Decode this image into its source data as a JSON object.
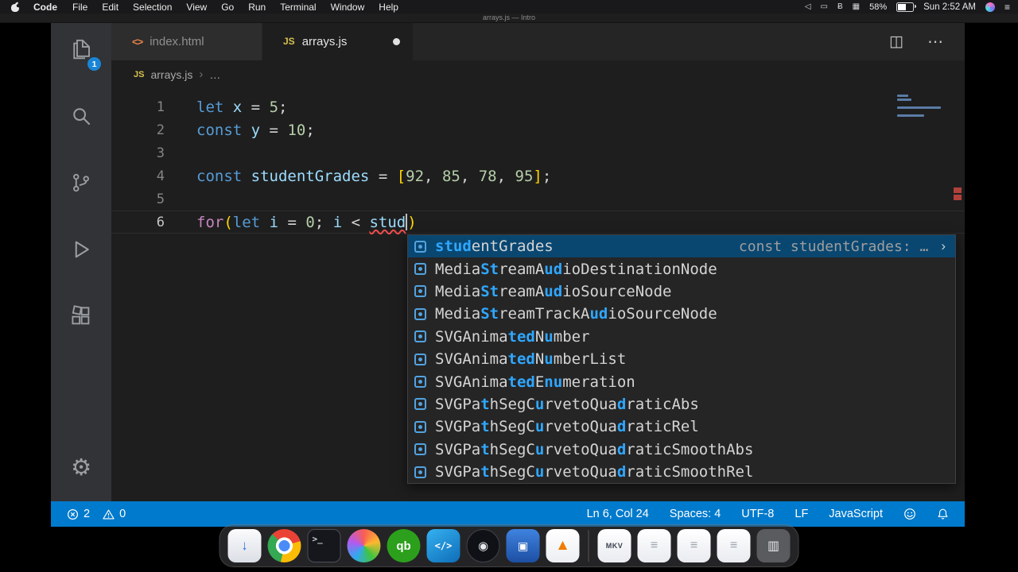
{
  "menubar": {
    "items": [
      "Code",
      "File",
      "Edit",
      "Selection",
      "View",
      "Go",
      "Run",
      "Terminal",
      "Window",
      "Help"
    ],
    "status_icons": [
      {
        "name": "volume-icon",
        "glyph": "◁"
      },
      {
        "name": "display-icon",
        "glyph": "▭"
      },
      {
        "name": "bluetooth-icon",
        "glyph": "Ƀ"
      },
      {
        "name": "keyboard-brightness-icon",
        "glyph": "▦"
      }
    ],
    "battery": "58%",
    "clock": "Sun 2:52 AM",
    "notification_icon": "≡"
  },
  "titlebar": {
    "title": "arrays.js — Intro"
  },
  "activity_bar": {
    "badge": "1"
  },
  "tabs": [
    {
      "label": "index.html",
      "icon_label": "<>",
      "icon_name": "html-file-icon",
      "icon_class": "tab-icon-html",
      "active": false,
      "dirty": false
    },
    {
      "label": "arrays.js",
      "icon_label": "JS",
      "icon_name": "js-file-icon",
      "icon_class": "tab-icon-js",
      "active": true,
      "dirty": true
    }
  ],
  "tab_actions": {
    "split": "◫",
    "more": "⋯"
  },
  "breadcrumb": {
    "icon_label": "JS",
    "file": "arrays.js",
    "separator": "›",
    "more": "…"
  },
  "editor": {
    "lines": [
      {
        "num": "1",
        "tokens": [
          {
            "t": "let",
            "c": "kw"
          },
          {
            "t": " "
          },
          {
            "t": "x",
            "c": "vr"
          },
          {
            "t": " = "
          },
          {
            "t": "5",
            "c": "nu"
          },
          {
            "t": ";"
          }
        ]
      },
      {
        "num": "2",
        "tokens": [
          {
            "t": "const",
            "c": "kw"
          },
          {
            "t": " "
          },
          {
            "t": "y",
            "c": "vr"
          },
          {
            "t": " = "
          },
          {
            "t": "10",
            "c": "nu"
          },
          {
            "t": ";"
          }
        ]
      },
      {
        "num": "3",
        "tokens": []
      },
      {
        "num": "4",
        "tokens": [
          {
            "t": "const",
            "c": "kw"
          },
          {
            "t": " "
          },
          {
            "t": "studentGrades",
            "c": "vr"
          },
          {
            "t": " = "
          },
          {
            "t": "[",
            "c": "br"
          },
          {
            "t": "92",
            "c": "nu"
          },
          {
            "t": ", "
          },
          {
            "t": "85",
            "c": "nu"
          },
          {
            "t": ", "
          },
          {
            "t": "78",
            "c": "nu"
          },
          {
            "t": ", "
          },
          {
            "t": "95",
            "c": "nu"
          },
          {
            "t": "]",
            "c": "br"
          },
          {
            "t": ";"
          }
        ]
      },
      {
        "num": "5",
        "tokens": []
      },
      {
        "num": "6",
        "current": true,
        "tokens": [
          {
            "t": "for",
            "c": "ct"
          },
          {
            "t": "(",
            "c": "br"
          },
          {
            "t": "let",
            "c": "kw"
          },
          {
            "t": " "
          },
          {
            "t": "i",
            "c": "vr"
          },
          {
            "t": " = "
          },
          {
            "t": "0",
            "c": "nu"
          },
          {
            "t": "; "
          },
          {
            "t": "i",
            "c": "vr"
          },
          {
            "t": " < "
          },
          {
            "t": "stud",
            "c": "er"
          },
          {
            "t": "",
            "c": "caret"
          },
          {
            "t": ")",
            "c": "br"
          }
        ]
      }
    ]
  },
  "suggest": {
    "items": [
      {
        "selected": true,
        "detail": "const studentGrades: …",
        "chevron": "›",
        "segments": [
          {
            "t": "stud",
            "h": true
          },
          {
            "t": "entGrades"
          }
        ]
      },
      {
        "segments": [
          {
            "t": "Media"
          },
          {
            "t": "St",
            "h": true
          },
          {
            "t": "reamA"
          },
          {
            "t": "ud",
            "h": true
          },
          {
            "t": "ioDestinationNode"
          }
        ]
      },
      {
        "segments": [
          {
            "t": "Media"
          },
          {
            "t": "St",
            "h": true
          },
          {
            "t": "reamA"
          },
          {
            "t": "ud",
            "h": true
          },
          {
            "t": "ioSourceNode"
          }
        ]
      },
      {
        "segments": [
          {
            "t": "Media"
          },
          {
            "t": "St",
            "h": true
          },
          {
            "t": "reamTrackA"
          },
          {
            "t": "ud",
            "h": true
          },
          {
            "t": "ioSourceNode"
          }
        ]
      },
      {
        "segments": [
          {
            "t": "SVGAnima"
          },
          {
            "t": "ted",
            "h": true
          },
          {
            "t": "N"
          },
          {
            "t": "u",
            "h": true
          },
          {
            "t": "mber"
          }
        ]
      },
      {
        "segments": [
          {
            "t": "SVGAnima"
          },
          {
            "t": "ted",
            "h": true
          },
          {
            "t": "N"
          },
          {
            "t": "u",
            "h": true
          },
          {
            "t": "mberList"
          }
        ]
      },
      {
        "segments": [
          {
            "t": "SVGAnima"
          },
          {
            "t": "ted",
            "h": true
          },
          {
            "t": "E"
          },
          {
            "t": "nu",
            "h": true
          },
          {
            "t": "meration"
          }
        ]
      },
      {
        "segments": [
          {
            "t": "SVGPa"
          },
          {
            "t": "t",
            "h": true
          },
          {
            "t": "hSegC"
          },
          {
            "t": "u",
            "h": true
          },
          {
            "t": "rvetoQua"
          },
          {
            "t": "d",
            "h": true
          },
          {
            "t": "raticAbs"
          }
        ]
      },
      {
        "segments": [
          {
            "t": "SVGPa"
          },
          {
            "t": "t",
            "h": true
          },
          {
            "t": "hSegC"
          },
          {
            "t": "u",
            "h": true
          },
          {
            "t": "rvetoQua"
          },
          {
            "t": "d",
            "h": true
          },
          {
            "t": "raticRel"
          }
        ]
      },
      {
        "segments": [
          {
            "t": "SVGPa"
          },
          {
            "t": "t",
            "h": true
          },
          {
            "t": "hSegC"
          },
          {
            "t": "u",
            "h": true
          },
          {
            "t": "rvetoQua"
          },
          {
            "t": "d",
            "h": true
          },
          {
            "t": "raticSmoothAbs"
          }
        ]
      },
      {
        "segments": [
          {
            "t": "SVGPa"
          },
          {
            "t": "t",
            "h": true
          },
          {
            "t": "hSegC"
          },
          {
            "t": "u",
            "h": true
          },
          {
            "t": "rvetoQua"
          },
          {
            "t": "d",
            "h": true
          },
          {
            "t": "raticSmoothRel"
          }
        ]
      }
    ]
  },
  "statusbar": {
    "errors": "2",
    "warnings": "0",
    "cursor": "Ln 6, Col 24",
    "indentation": "Spaces: 4",
    "encoding": "UTF-8",
    "eol": "LF",
    "language": "JavaScript"
  },
  "dock": {
    "items": [
      {
        "name": "app-downloads",
        "style": "white",
        "glyph": "↓"
      },
      {
        "name": "google-chrome",
        "style": "chrome",
        "glyph": ""
      },
      {
        "name": "terminal",
        "style": "terminal",
        "glyph": ">_"
      },
      {
        "name": "app-colorwheel",
        "style": "pin",
        "glyph": ""
      },
      {
        "name": "quickbooks",
        "style": "qb",
        "glyph": "qb"
      },
      {
        "name": "vs-code",
        "style": "vscode",
        "glyph": "</>"
      },
      {
        "name": "obs",
        "style": "obs",
        "glyph": "◉"
      },
      {
        "name": "app-blue",
        "style": "blue",
        "glyph": "▣"
      },
      {
        "name": "vlc",
        "style": "vlc",
        "glyph": "▲"
      },
      {
        "divider": true
      },
      {
        "name": "file-mkv",
        "style": "mkv",
        "glyph": "MKV"
      },
      {
        "name": "file-doc-1",
        "style": "file",
        "glyph": "≡"
      },
      {
        "name": "file-doc-2",
        "style": "file",
        "glyph": "≡"
      },
      {
        "name": "file-doc-3",
        "style": "file",
        "glyph": "≡"
      },
      {
        "name": "trash",
        "style": "trash",
        "glyph": "▥"
      }
    ]
  },
  "colors": {
    "accent": "#007acc",
    "error": "#f14c4c",
    "match": "#2fa7ff",
    "badge": "#1a85d6"
  }
}
